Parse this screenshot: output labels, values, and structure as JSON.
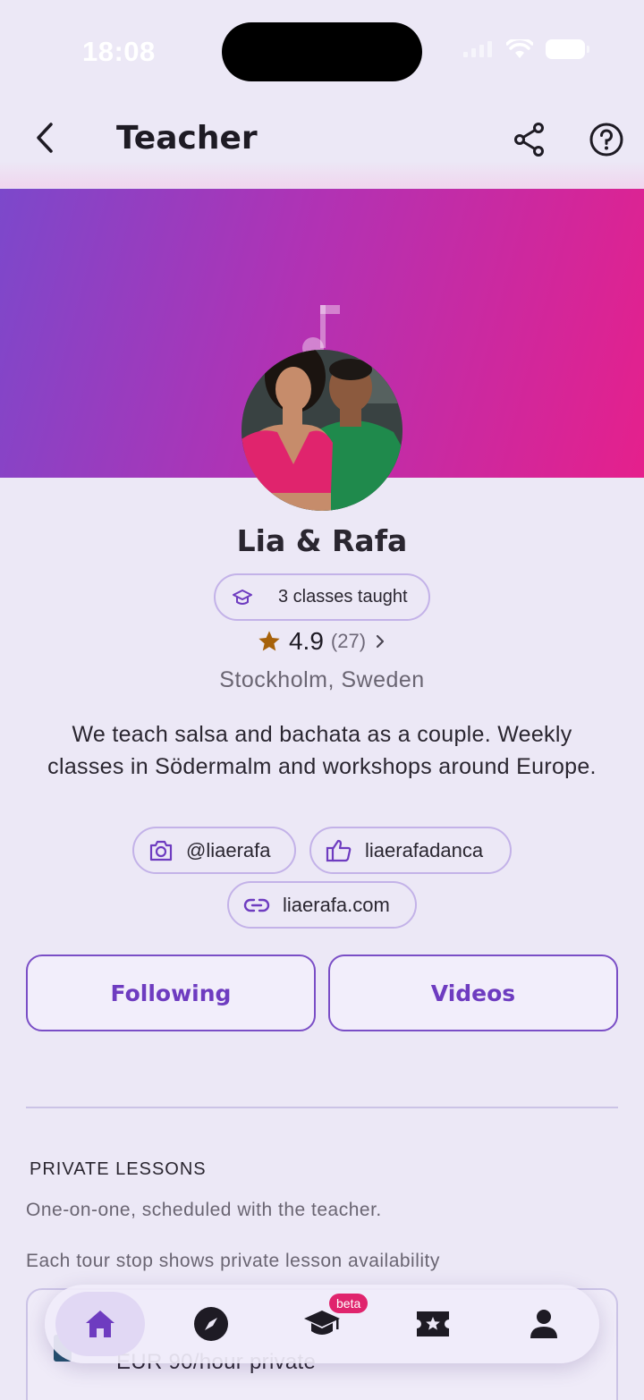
{
  "status_bar": {
    "time": "18:08"
  },
  "header": {
    "title": "Teacher"
  },
  "profile": {
    "name": "Lia & Rafa",
    "classes_taught": "3 classes taught",
    "rating": "4.9",
    "rating_count": "(27)",
    "location": "Stockholm, Sweden",
    "bio": "We teach salsa and bachata as a couple. Weekly classes in Södermalm and workshops around Europe."
  },
  "social": {
    "instagram": "@liaerafa",
    "facebook": "liaerafadanca",
    "website": "liaerafa.com"
  },
  "actions": {
    "following_label": "Following",
    "videos_label": "Videos"
  },
  "private_lessons": {
    "title": "PRIVATE LESSONS",
    "subtitle": "One-on-one, scheduled with the teacher.",
    "note": "Each tour stop shows private lesson availability",
    "price": "EUR 90/hour private"
  },
  "tabbar": {
    "items": [
      "home",
      "explore",
      "classes",
      "events",
      "profile"
    ],
    "beta_label": "beta"
  },
  "colors": {
    "accent": "#6e3cc0",
    "banner_start": "#7c48cb",
    "banner_end": "#e5208c",
    "star": "#a7620a"
  }
}
